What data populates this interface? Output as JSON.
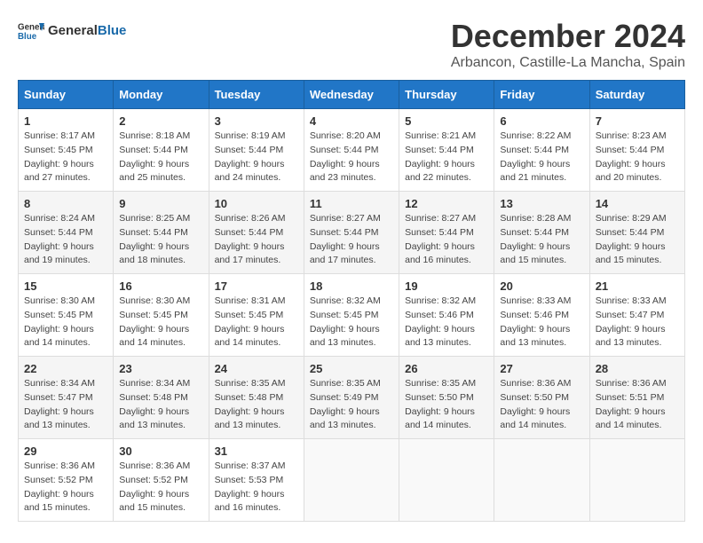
{
  "logo": {
    "text_general": "General",
    "text_blue": "Blue"
  },
  "header": {
    "title": "December 2024",
    "subtitle": "Arbancon, Castille-La Mancha, Spain"
  },
  "weekdays": [
    "Sunday",
    "Monday",
    "Tuesday",
    "Wednesday",
    "Thursday",
    "Friday",
    "Saturday"
  ],
  "weeks": [
    [
      {
        "day": "1",
        "sunrise": "8:17 AM",
        "sunset": "5:45 PM",
        "daylight": "9 hours and 27 minutes."
      },
      {
        "day": "2",
        "sunrise": "8:18 AM",
        "sunset": "5:44 PM",
        "daylight": "9 hours and 25 minutes."
      },
      {
        "day": "3",
        "sunrise": "8:19 AM",
        "sunset": "5:44 PM",
        "daylight": "9 hours and 24 minutes."
      },
      {
        "day": "4",
        "sunrise": "8:20 AM",
        "sunset": "5:44 PM",
        "daylight": "9 hours and 23 minutes."
      },
      {
        "day": "5",
        "sunrise": "8:21 AM",
        "sunset": "5:44 PM",
        "daylight": "9 hours and 22 minutes."
      },
      {
        "day": "6",
        "sunrise": "8:22 AM",
        "sunset": "5:44 PM",
        "daylight": "9 hours and 21 minutes."
      },
      {
        "day": "7",
        "sunrise": "8:23 AM",
        "sunset": "5:44 PM",
        "daylight": "9 hours and 20 minutes."
      }
    ],
    [
      {
        "day": "8",
        "sunrise": "8:24 AM",
        "sunset": "5:44 PM",
        "daylight": "9 hours and 19 minutes."
      },
      {
        "day": "9",
        "sunrise": "8:25 AM",
        "sunset": "5:44 PM",
        "daylight": "9 hours and 18 minutes."
      },
      {
        "day": "10",
        "sunrise": "8:26 AM",
        "sunset": "5:44 PM",
        "daylight": "9 hours and 17 minutes."
      },
      {
        "day": "11",
        "sunrise": "8:27 AM",
        "sunset": "5:44 PM",
        "daylight": "9 hours and 17 minutes."
      },
      {
        "day": "12",
        "sunrise": "8:27 AM",
        "sunset": "5:44 PM",
        "daylight": "9 hours and 16 minutes."
      },
      {
        "day": "13",
        "sunrise": "8:28 AM",
        "sunset": "5:44 PM",
        "daylight": "9 hours and 15 minutes."
      },
      {
        "day": "14",
        "sunrise": "8:29 AM",
        "sunset": "5:44 PM",
        "daylight": "9 hours and 15 minutes."
      }
    ],
    [
      {
        "day": "15",
        "sunrise": "8:30 AM",
        "sunset": "5:45 PM",
        "daylight": "9 hours and 14 minutes."
      },
      {
        "day": "16",
        "sunrise": "8:30 AM",
        "sunset": "5:45 PM",
        "daylight": "9 hours and 14 minutes."
      },
      {
        "day": "17",
        "sunrise": "8:31 AM",
        "sunset": "5:45 PM",
        "daylight": "9 hours and 14 minutes."
      },
      {
        "day": "18",
        "sunrise": "8:32 AM",
        "sunset": "5:45 PM",
        "daylight": "9 hours and 13 minutes."
      },
      {
        "day": "19",
        "sunrise": "8:32 AM",
        "sunset": "5:46 PM",
        "daylight": "9 hours and 13 minutes."
      },
      {
        "day": "20",
        "sunrise": "8:33 AM",
        "sunset": "5:46 PM",
        "daylight": "9 hours and 13 minutes."
      },
      {
        "day": "21",
        "sunrise": "8:33 AM",
        "sunset": "5:47 PM",
        "daylight": "9 hours and 13 minutes."
      }
    ],
    [
      {
        "day": "22",
        "sunrise": "8:34 AM",
        "sunset": "5:47 PM",
        "daylight": "9 hours and 13 minutes."
      },
      {
        "day": "23",
        "sunrise": "8:34 AM",
        "sunset": "5:48 PM",
        "daylight": "9 hours and 13 minutes."
      },
      {
        "day": "24",
        "sunrise": "8:35 AM",
        "sunset": "5:48 PM",
        "daylight": "9 hours and 13 minutes."
      },
      {
        "day": "25",
        "sunrise": "8:35 AM",
        "sunset": "5:49 PM",
        "daylight": "9 hours and 13 minutes."
      },
      {
        "day": "26",
        "sunrise": "8:35 AM",
        "sunset": "5:50 PM",
        "daylight": "9 hours and 14 minutes."
      },
      {
        "day": "27",
        "sunrise": "8:36 AM",
        "sunset": "5:50 PM",
        "daylight": "9 hours and 14 minutes."
      },
      {
        "day": "28",
        "sunrise": "8:36 AM",
        "sunset": "5:51 PM",
        "daylight": "9 hours and 14 minutes."
      }
    ],
    [
      {
        "day": "29",
        "sunrise": "8:36 AM",
        "sunset": "5:52 PM",
        "daylight": "9 hours and 15 minutes."
      },
      {
        "day": "30",
        "sunrise": "8:36 AM",
        "sunset": "5:52 PM",
        "daylight": "9 hours and 15 minutes."
      },
      {
        "day": "31",
        "sunrise": "8:37 AM",
        "sunset": "5:53 PM",
        "daylight": "9 hours and 16 minutes."
      },
      null,
      null,
      null,
      null
    ]
  ],
  "labels": {
    "sunrise": "Sunrise:",
    "sunset": "Sunset:",
    "daylight": "Daylight:"
  }
}
